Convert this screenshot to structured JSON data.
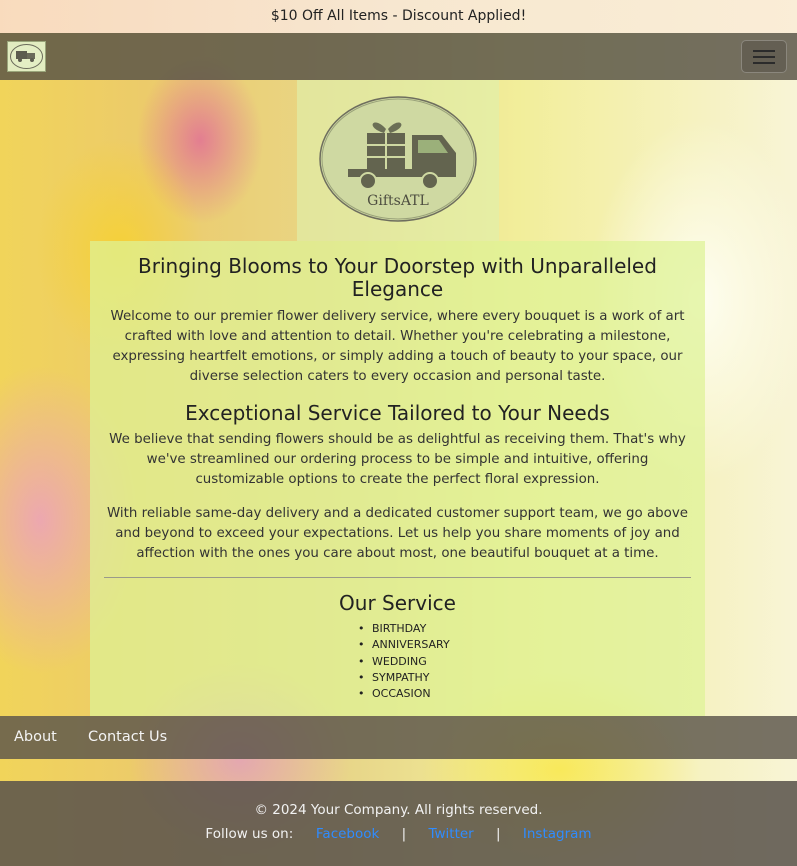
{
  "banner": {
    "text": "$10 Off All Items - Discount Applied!"
  },
  "navbar": {
    "logo_icon": "giftsatl-truck-logo-icon",
    "toggle_icon": "hamburger-menu-icon"
  },
  "hero_logo": {
    "brand_text": "GiftsATL",
    "icon": "gift-truck-icon"
  },
  "main": {
    "heading": "Bringing Blooms to Your Doorstep with Unparalleled Elegance",
    "intro": "Welcome to our premier flower delivery service, where every bouquet is a work of art crafted with love and attention to detail. Whether you're celebrating a milestone, expressing heartfelt emotions, or simply adding a touch of beauty to your space, our diverse selection caters to every occasion and personal taste.",
    "subheading": "Exceptional Service Tailored to Your Needs",
    "para2": "We believe that sending flowers should be as delightful as receiving them. That's why we've streamlined our ordering process to be simple and intuitive, offering customizable options to create the perfect floral expression.",
    "para3": "With reliable same-day delivery and a dedicated customer support team, we go above and beyond to exceed your expectations. Let us help you share moments of joy and affection with the ones you care about most, one beautiful bouquet at a time.",
    "service_heading": "Our Service",
    "services": [
      "BIRTHDAY",
      "ANNIVERSARY",
      "WEDDING",
      "SYMPATHY",
      "OCCASION"
    ]
  },
  "footer_nav": {
    "about": "About",
    "contact": "Contact Us"
  },
  "footer": {
    "copyright": "© 2024 Your Company. All rights reserved.",
    "follow_label": "Follow us on:",
    "separator": "|",
    "links": [
      "Facebook",
      "Twitter",
      "Instagram"
    ]
  },
  "colors": {
    "link": "#2f8cff",
    "panel": "#def296",
    "bar": "#5a544b"
  }
}
